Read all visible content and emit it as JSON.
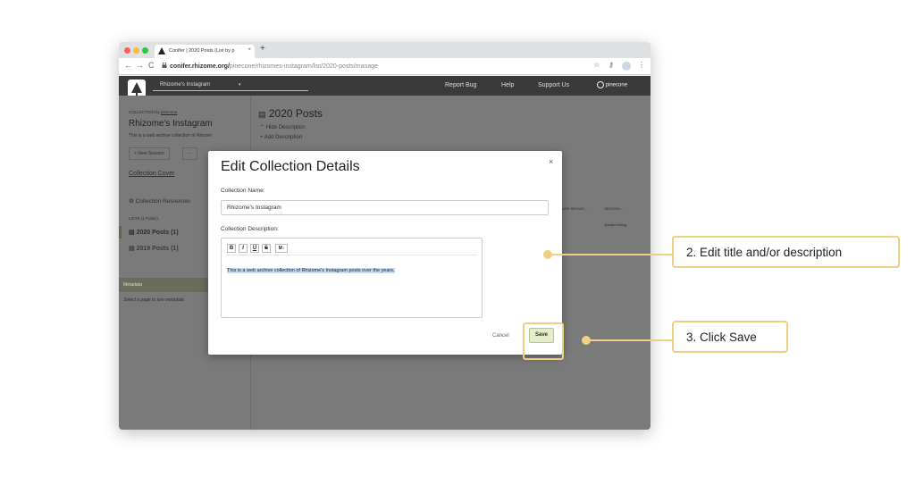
{
  "browser": {
    "tab_title": "Conifer | 2020 Posts (List by p",
    "tab_close": "×",
    "new_tab": "+",
    "back": "←",
    "forward": "→",
    "reload": "C",
    "url_domain": "conifer.rhizome.org/",
    "url_path": "pinecone/rhizomes-instagram/list/2020-posts/manage"
  },
  "app": {
    "collection_select": "Rhizome's Instagram",
    "nav": [
      "Report Bug",
      "Help",
      "Support Us"
    ],
    "user": "pinecone"
  },
  "sidebar": {
    "collection_by": "COLLECTION by",
    "collection_owner": "pinecone",
    "collection_title": "Rhizome's Instagram",
    "collection_desc": "This is a web archive collection of Rhizom",
    "new_session": "+ New Session",
    "more": "···",
    "collection_cover": "Collection Cover",
    "collection_resources": "Collection Resources",
    "lists_header": "LISTS (1 Public)",
    "lists": [
      "2020 Posts (1)",
      "2019 Posts (1)"
    ],
    "metadata": "Metadata",
    "metadata_hint": "Select a page to see metadata"
  },
  "main": {
    "list_title": "2020 Posts",
    "hide_description": "Hide Description",
    "add_description": "+ Add Description",
    "col_browser": "URE BROWS...",
    "col_session": "SESSION ...",
    "row_session": "@daijirtmthwg"
  },
  "modal": {
    "title": "Edit Collection Details",
    "close": "×",
    "name_label": "Collection Name:",
    "name_value": "Rhizome's Instagram",
    "desc_label": "Collection Description:",
    "toolbar": [
      "B",
      "I",
      "U",
      "S",
      "M↓"
    ],
    "desc_value": "This is a web archive collection of Rhizome's Instagram posts over the years.",
    "cancel": "Cancel",
    "save": "Save"
  },
  "callouts": [
    {
      "label": "2. Edit title and/or description"
    },
    {
      "label": "3. Click Save"
    }
  ],
  "colors": {
    "highlight": "#efcf83",
    "app_bar": "#3a3a3a",
    "dim": "#7a7a7a"
  }
}
